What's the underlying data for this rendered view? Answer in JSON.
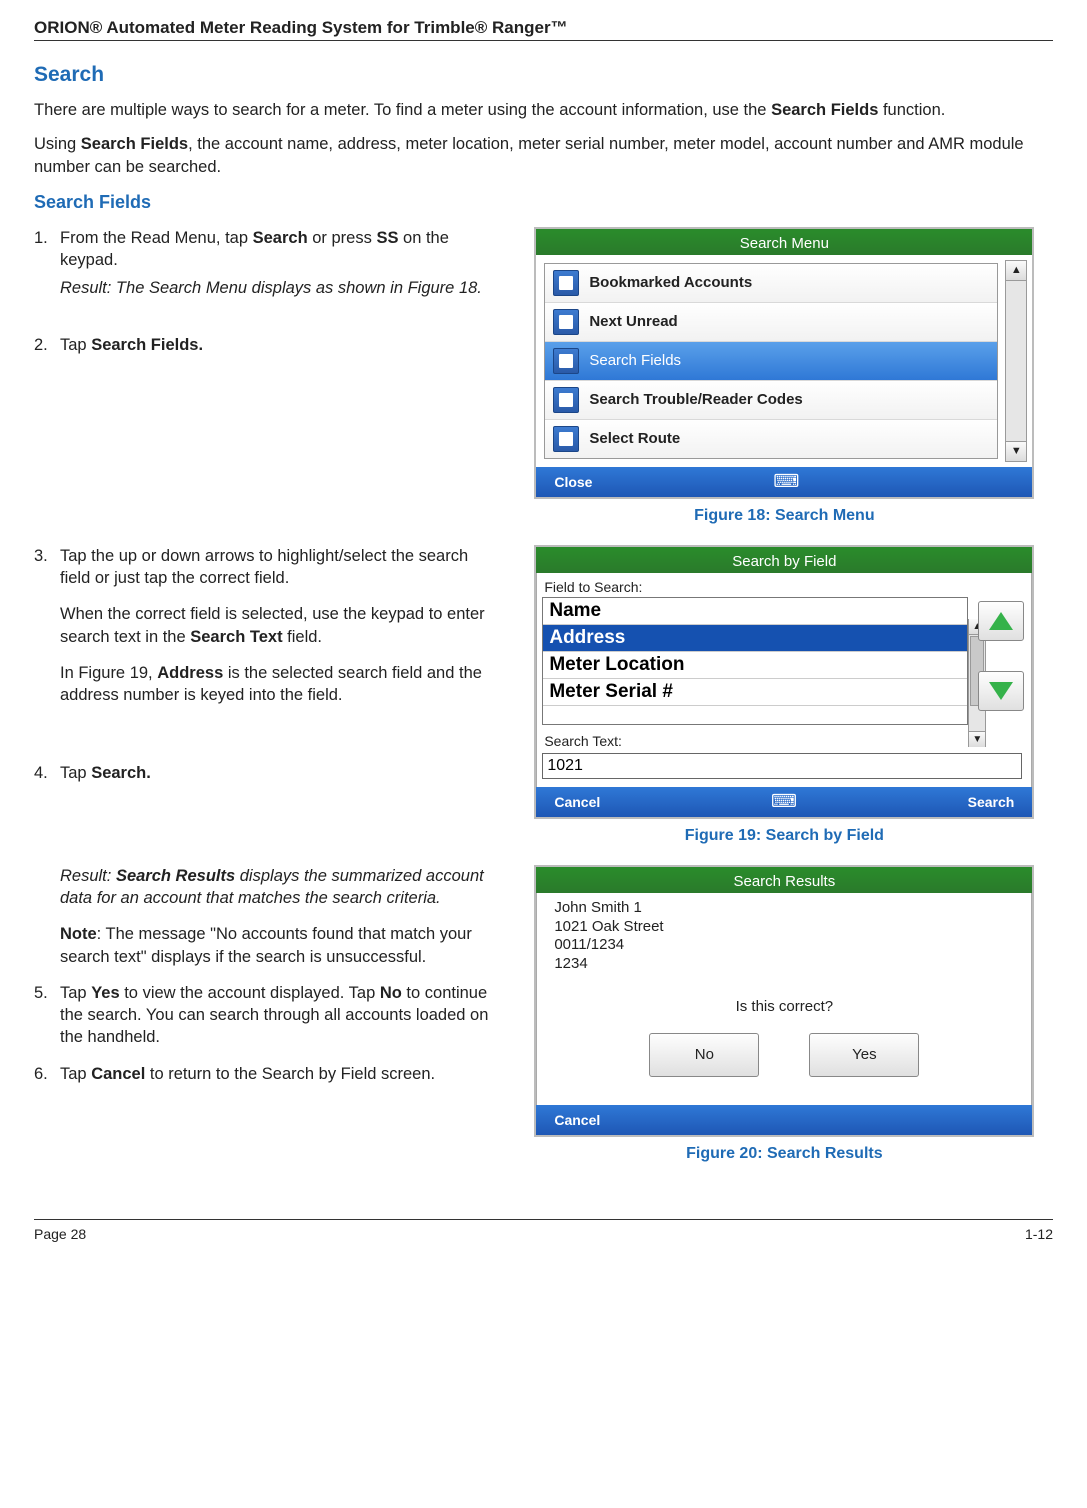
{
  "doc": {
    "header": "ORION® Automated Meter Reading System for Trimble® Ranger™",
    "page_left": "Page 28",
    "page_right": "1-12"
  },
  "section": {
    "title": "Search",
    "sub": "Search Fields"
  },
  "intro1a": "There are multiple ways to search for a meter. To find a meter using the account information, use the ",
  "intro1b": "Search Fields",
  "intro1c": " function.",
  "intro2a": "Using ",
  "intro2b": "Search Fields",
  "intro2c": ", the account name, address, meter location, meter serial number, meter model, account number and AMR module number can be searched.",
  "steps": {
    "s1a": "From the Read Menu, tap ",
    "s1b": "Search",
    "s1c": " or press ",
    "s1d": "SS",
    "s1e": " on the keypad.",
    "s1r": "Result: The Search Menu displays as shown in Figure 18.",
    "s2a": "Tap ",
    "s2b": "Search Fields.",
    "s3a": "Tap the up or down arrows to highlight/select the search field or just tap the correct field.",
    "s3b1": "When the correct field is selected, use the keypad to enter search text in the ",
    "s3b2": "Search Text",
    "s3b3": " field.",
    "s3c1": "In Figure 19, ",
    "s3c2": "Address",
    "s3c3": " is the selected search field and the address number is keyed into the field.",
    "s4a": "Tap ",
    "s4b": "Search.",
    "s4r1": "Result: ",
    "s4r2": "Search Results",
    "s4r3": " displays the summarized account data for an account that matches the search criteria.",
    "s4n1": "Note",
    "s4n2": ": The message \"No accounts found that match your search text\" displays if the search is unsuccessful.",
    "s5a": "Tap ",
    "s5b": "Yes",
    "s5c": " to view the account displayed. Tap ",
    "s5d": "No",
    "s5e": " to continue the search. You can search through all accounts loaded on the handheld.",
    "s6a": "Tap ",
    "s6b": "Cancel",
    "s6c": " to return to the Search by Field screen."
  },
  "fig18": {
    "title": "Search Menu",
    "items": [
      "Bookmarked Accounts",
      "Next Unread",
      "Search Fields",
      "Search Trouble/Reader Codes",
      "Select Route"
    ],
    "close": "Close",
    "caption": "Figure 18:  Search Menu"
  },
  "fig19": {
    "title": "Search by Field",
    "lbl_field": "Field to Search:",
    "rows": [
      "Name",
      "Address",
      "Meter Location",
      "Meter Serial #"
    ],
    "lbl_text": "Search Text:",
    "value": "1021",
    "cancel": "Cancel",
    "search": "Search",
    "caption": "Figure 19:  Search by Field"
  },
  "fig20": {
    "title": "Search Results",
    "lines": [
      "John  Smith 1",
      "1021 Oak Street",
      "0011/1234",
      "1234"
    ],
    "prompt": "Is this correct?",
    "no": "No",
    "yes": "Yes",
    "cancel": "Cancel",
    "caption": "Figure 20:  Search Results"
  }
}
